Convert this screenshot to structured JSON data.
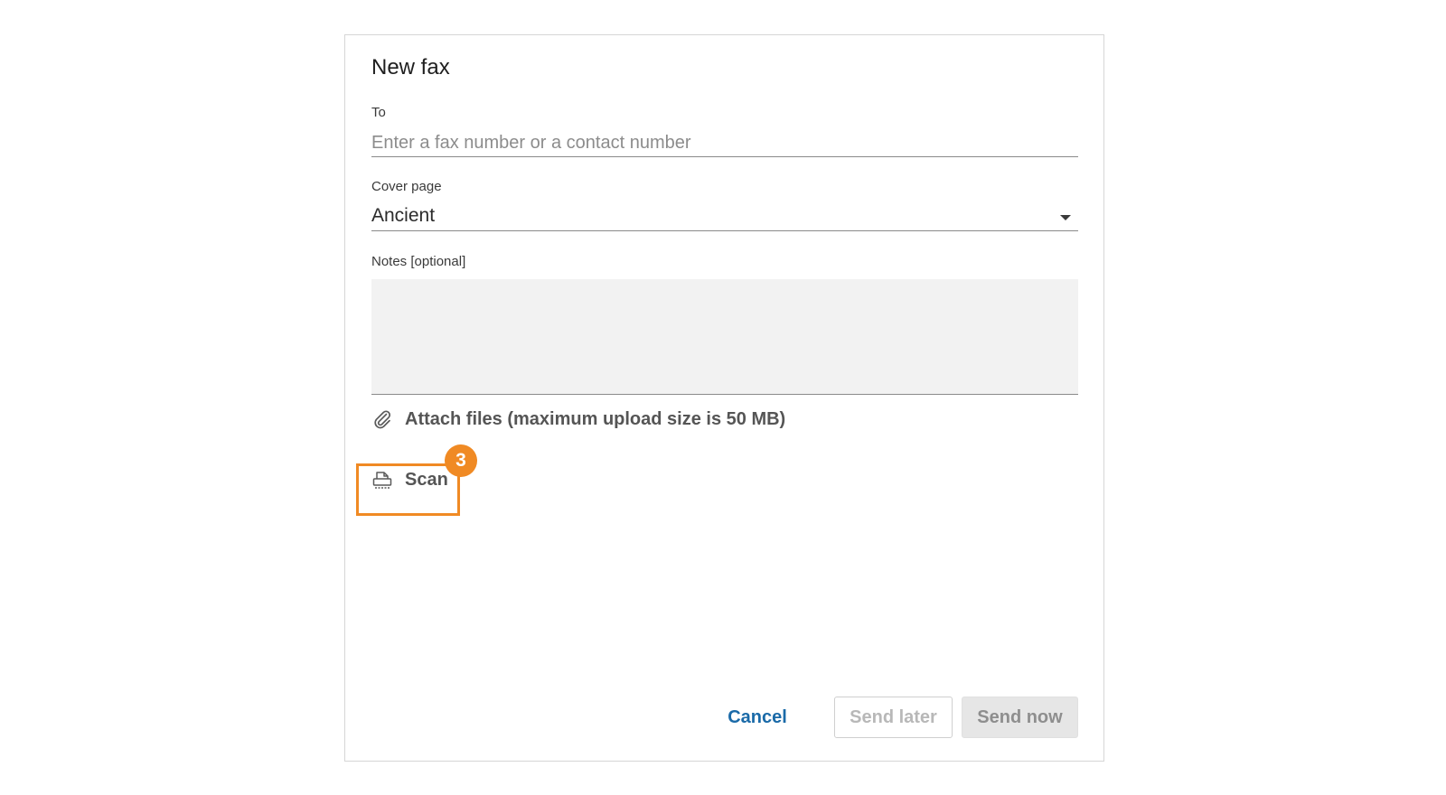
{
  "dialog": {
    "title": "New fax"
  },
  "to_field": {
    "label": "To",
    "placeholder": "Enter a fax number or a contact number",
    "value": ""
  },
  "cover_page": {
    "label": "Cover page",
    "selected": "Ancient"
  },
  "notes": {
    "label": "Notes [optional]",
    "value": ""
  },
  "attach": {
    "icon": "paperclip-icon",
    "label": "Attach files (maximum upload size is 50 MB)"
  },
  "scan": {
    "icon": "scanner-icon",
    "label": "Scan"
  },
  "callout": {
    "step": "3",
    "color": "#f08a24"
  },
  "footer": {
    "cancel_label": "Cancel",
    "send_later_label": "Send later",
    "send_now_label": "Send now"
  },
  "colors": {
    "link_blue": "#1a6aa8",
    "disabled_text": "#b8b8b8",
    "notes_bg": "#f2f2f2"
  }
}
